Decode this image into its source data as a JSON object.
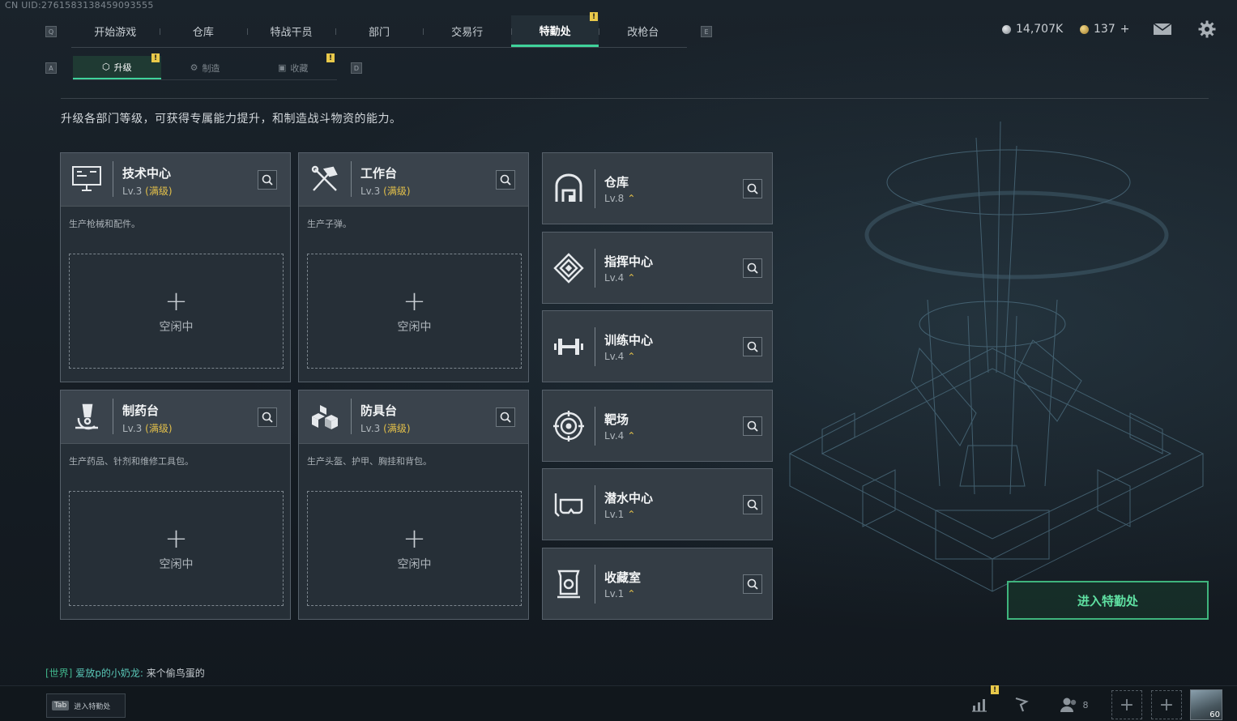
{
  "uid": "CN UID:2761583138459093555",
  "nav": {
    "key_left": "Q",
    "key_right": "E",
    "tabs": [
      {
        "label": "开始游戏"
      },
      {
        "label": "仓库"
      },
      {
        "label": "特战干员"
      },
      {
        "label": "部门"
      },
      {
        "label": "交易行"
      },
      {
        "label": "特勤处",
        "active": true,
        "alert": true
      },
      {
        "label": "改枪台"
      }
    ]
  },
  "currency": {
    "silver": "14,707K",
    "gold": "137",
    "gold_add": "+"
  },
  "subnav": {
    "key_left": "A",
    "key_right": "D",
    "tabs": [
      {
        "label": "升级",
        "active": true,
        "alert": true
      },
      {
        "label": "制造"
      },
      {
        "label": "收藏",
        "alert": true
      }
    ]
  },
  "alert_mark": "!",
  "description": "升级各部门等级，可获得专属能力提升，和制造战斗物资的能力。",
  "workshops": [
    {
      "title": "技术中心",
      "level": "Lv.3",
      "max": "(满级)",
      "desc": "生产枪械和配件。",
      "slot_plus": "+",
      "slot_status": "空闲中",
      "icon": "computer-icon"
    },
    {
      "title": "工作台",
      "level": "Lv.3",
      "max": "(满级)",
      "desc": "生产子弹。",
      "slot_plus": "+",
      "slot_status": "空闲中",
      "icon": "tools-icon"
    },
    {
      "title": "制药台",
      "level": "Lv.3",
      "max": "(满级)",
      "desc": "生产药品、针剂和维修工具包。",
      "slot_plus": "+",
      "slot_status": "空闲中",
      "icon": "microscope-icon"
    },
    {
      "title": "防具台",
      "level": "Lv.3",
      "max": "(满级)",
      "desc": "生产头盔、护甲、胸挂和背包。",
      "slot_plus": "+",
      "slot_status": "空闲中",
      "icon": "blocks-icon"
    }
  ],
  "facilities": [
    {
      "title": "仓库",
      "level": "Lv.8",
      "icon": "warehouse-icon"
    },
    {
      "title": "指挥中心",
      "level": "Lv.4",
      "icon": "command-icon"
    },
    {
      "title": "训练中心",
      "level": "Lv.4",
      "icon": "dumbbell-icon"
    },
    {
      "title": "靶场",
      "level": "Lv.4",
      "icon": "target-icon"
    },
    {
      "title": "潜水中心",
      "level": "Lv.1",
      "icon": "diving-mask-icon"
    },
    {
      "title": "收藏室",
      "level": "Lv.1",
      "icon": "collection-icon"
    }
  ],
  "upgrade_glyph": "⌃",
  "enter_button": "进入特勤处",
  "chat": {
    "channel": "[世界]",
    "name": "爱放p的小奶龙:",
    "message": "来个偷鸟蛋的"
  },
  "bottom": {
    "tab_key": "Tab",
    "tab_label": "进入特勤处",
    "friends_count": "8",
    "add": "+",
    "avatar_level": "60"
  },
  "colors": {
    "accent": "#3fd39b",
    "max_level": "#e3c04a",
    "alert": "#e9c94a"
  }
}
